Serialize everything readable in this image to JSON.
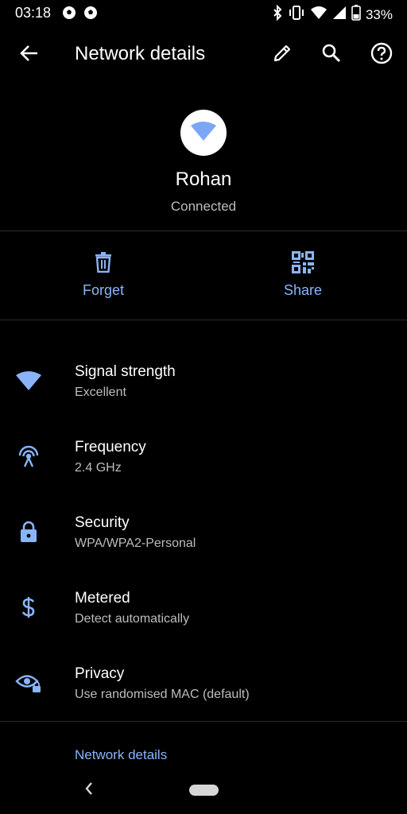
{
  "status_bar": {
    "time": "03:18",
    "battery": "33%",
    "left_icons": [
      "soccer-ball-icon",
      "soccer-ball-icon"
    ],
    "right_icons": [
      "bluetooth-icon",
      "vibrate-icon",
      "wifi-icon",
      "signal-icon",
      "battery-icon"
    ]
  },
  "app_bar": {
    "title": "Network details",
    "back_icon": "arrow-back-icon",
    "actions": [
      "edit-icon",
      "search-icon",
      "help-icon"
    ]
  },
  "network": {
    "name": "Rohan",
    "status": "Connected"
  },
  "actions": [
    {
      "label": "Forget",
      "icon": "trash-icon"
    },
    {
      "label": "Share",
      "icon": "qr-code-icon"
    }
  ],
  "details": [
    {
      "title": "Signal strength",
      "value": "Excellent",
      "icon": "wifi-signal-icon"
    },
    {
      "title": "Frequency",
      "value": "2.4 GHz",
      "icon": "antenna-icon"
    },
    {
      "title": "Security",
      "value": "WPA/WPA2-Personal",
      "icon": "lock-icon"
    },
    {
      "title": "Metered",
      "value": "Detect automatically",
      "icon": "dollar-icon"
    },
    {
      "title": "Privacy",
      "value": "Use randomised MAC (default)",
      "icon": "eye-lock-icon"
    }
  ],
  "section_link": "Network details",
  "colors": {
    "background": "#000000",
    "accent": "#8ab4f8",
    "secondary_text": "#bdbdbd",
    "divider": "#2c2c2c"
  }
}
